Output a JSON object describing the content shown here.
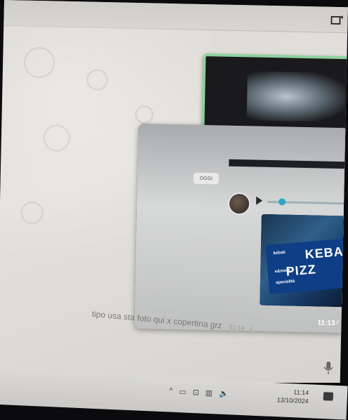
{
  "chat": {
    "inner_date_chip": "OGGI",
    "image_bubble_time": "11:13",
    "image_bubble_check": "✓",
    "caption": "tipo usa sta foto qui x copertina grz",
    "caption_time": "11:14",
    "caption_check": "✓",
    "forward_glyph": "➦"
  },
  "inner_photo": {
    "sign_line1": "KEBA",
    "sign_line2": "PIZZ",
    "sign_small_1": "kebab",
    "sign_small_2": "e&more",
    "sign_small_3": "specialità"
  },
  "taskbar": {
    "tray_glyphs": [
      "^",
      "▭",
      "⊡",
      "▥",
      "🔈"
    ],
    "time": "11:14",
    "date": "13/10/2024"
  },
  "colors": {
    "chat_bg": "#e3e1dc",
    "bubble_border": "#8fd19e",
    "sign_blue": "#0f3e86"
  }
}
